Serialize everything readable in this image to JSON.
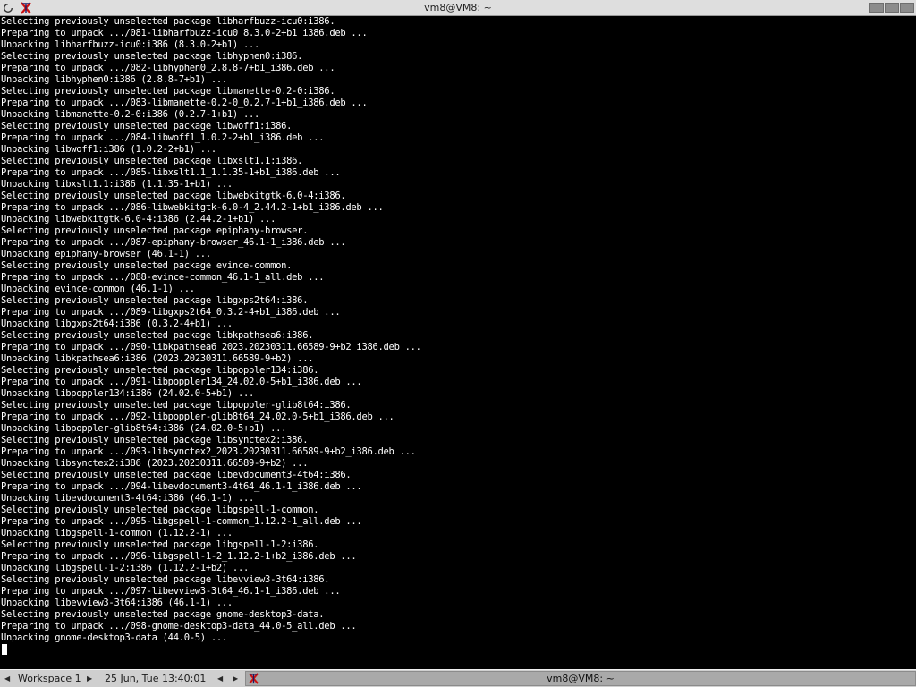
{
  "window": {
    "title": "vm8@VM8: ~"
  },
  "titlebar_icons": [
    "menu-icon",
    "xterm-icon"
  ],
  "terminal": {
    "lines": [
      "Selecting previously unselected package libharfbuzz-icu0:i386.",
      "Preparing to unpack .../081-libharfbuzz-icu0_8.3.0-2+b1_i386.deb ...",
      "Unpacking libharfbuzz-icu0:i386 (8.3.0-2+b1) ...",
      "Selecting previously unselected package libhyphen0:i386.",
      "Preparing to unpack .../082-libhyphen0_2.8.8-7+b1_i386.deb ...",
      "Unpacking libhyphen0:i386 (2.8.8-7+b1) ...",
      "Selecting previously unselected package libmanette-0.2-0:i386.",
      "Preparing to unpack .../083-libmanette-0.2-0_0.2.7-1+b1_i386.deb ...",
      "Unpacking libmanette-0.2-0:i386 (0.2.7-1+b1) ...",
      "Selecting previously unselected package libwoff1:i386.",
      "Preparing to unpack .../084-libwoff1_1.0.2-2+b1_i386.deb ...",
      "Unpacking libwoff1:i386 (1.0.2-2+b1) ...",
      "Selecting previously unselected package libxslt1.1:i386.",
      "Preparing to unpack .../085-libxslt1.1_1.1.35-1+b1_i386.deb ...",
      "Unpacking libxslt1.1:i386 (1.1.35-1+b1) ...",
      "Selecting previously unselected package libwebkitgtk-6.0-4:i386.",
      "Preparing to unpack .../086-libwebkitgtk-6.0-4_2.44.2-1+b1_i386.deb ...",
      "Unpacking libwebkitgtk-6.0-4:i386 (2.44.2-1+b1) ...",
      "Selecting previously unselected package epiphany-browser.",
      "Preparing to unpack .../087-epiphany-browser_46.1-1_i386.deb ...",
      "Unpacking epiphany-browser (46.1-1) ...",
      "Selecting previously unselected package evince-common.",
      "Preparing to unpack .../088-evince-common_46.1-1_all.deb ...",
      "Unpacking evince-common (46.1-1) ...",
      "Selecting previously unselected package libgxps2t64:i386.",
      "Preparing to unpack .../089-libgxps2t64_0.3.2-4+b1_i386.deb ...",
      "Unpacking libgxps2t64:i386 (0.3.2-4+b1) ...",
      "Selecting previously unselected package libkpathsea6:i386.",
      "Preparing to unpack .../090-libkpathsea6_2023.20230311.66589-9+b2_i386.deb ...",
      "Unpacking libkpathsea6:i386 (2023.20230311.66589-9+b2) ...",
      "Selecting previously unselected package libpoppler134:i386.",
      "Preparing to unpack .../091-libpoppler134_24.02.0-5+b1_i386.deb ...",
      "Unpacking libpoppler134:i386 (24.02.0-5+b1) ...",
      "Selecting previously unselected package libpoppler-glib8t64:i386.",
      "Preparing to unpack .../092-libpoppler-glib8t64_24.02.0-5+b1_i386.deb ...",
      "Unpacking libpoppler-glib8t64:i386 (24.02.0-5+b1) ...",
      "Selecting previously unselected package libsynctex2:i386.",
      "Preparing to unpack .../093-libsynctex2_2023.20230311.66589-9+b2_i386.deb ...",
      "Unpacking libsynctex2:i386 (2023.20230311.66589-9+b2) ...",
      "Selecting previously unselected package libevdocument3-4t64:i386.",
      "Preparing to unpack .../094-libevdocument3-4t64_46.1-1_i386.deb ...",
      "Unpacking libevdocument3-4t64:i386 (46.1-1) ...",
      "Selecting previously unselected package libgspell-1-common.",
      "Preparing to unpack .../095-libgspell-1-common_1.12.2-1_all.deb ...",
      "Unpacking libgspell-1-common (1.12.2-1) ...",
      "Selecting previously unselected package libgspell-1-2:i386.",
      "Preparing to unpack .../096-libgspell-1-2_1.12.2-1+b2_i386.deb ...",
      "Unpacking libgspell-1-2:i386 (1.12.2-1+b2) ...",
      "Selecting previously unselected package libevview3-3t64:i386.",
      "Preparing to unpack .../097-libevview3-3t64_46.1-1_i386.deb ...",
      "Unpacking libevview3-3t64:i386 (46.1-1) ...",
      "Selecting previously unselected package gnome-desktop3-data.",
      "Preparing to unpack .../098-gnome-desktop3-data_44.0-5_all.deb ...",
      "Unpacking gnome-desktop3-data (44.0-5) ..."
    ]
  },
  "taskbar": {
    "workspace_label": "Workspace 1",
    "datetime": "25 Jun, Tue 13:40:01",
    "task_title": "vm8@VM8: ~"
  },
  "colors": {
    "terminal_bg": "#000000",
    "terminal_fg": "#ffffff",
    "titlebar_bg": "#dedede",
    "taskbar_bg": "#cfcfcf",
    "task_active_bg": "#a9a9a9",
    "xterm_icon_red": "#cc1111"
  }
}
